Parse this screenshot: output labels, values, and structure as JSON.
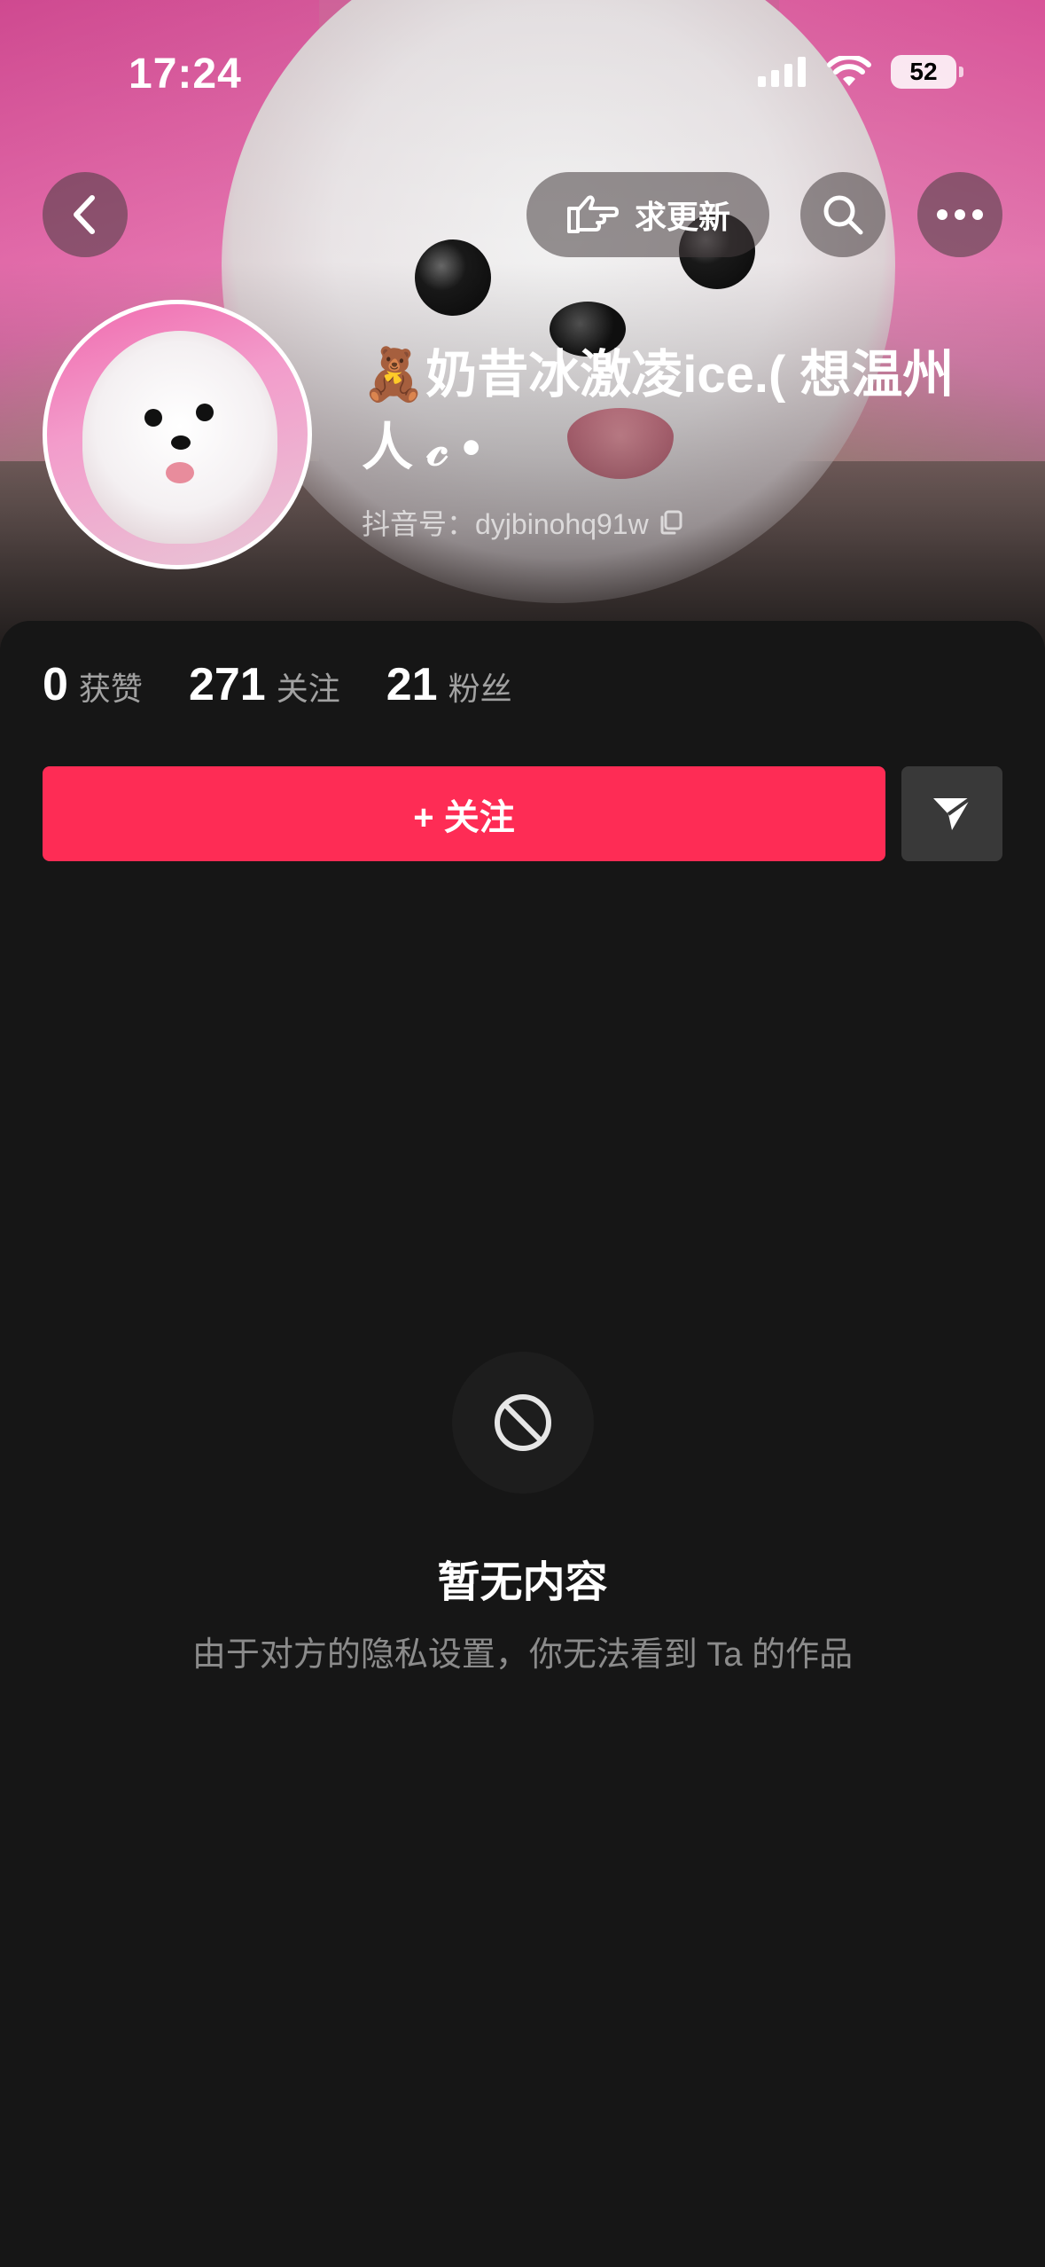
{
  "status_bar": {
    "time": "17:24",
    "battery": "52"
  },
  "header": {
    "update_label": "求更新",
    "name": "🧸奶昔冰激凌ice.( 想温州人 𝒸 •",
    "douyin_id": "抖音号：dyjbinohq91w"
  },
  "stats": [
    {
      "value": "0",
      "label": "获赞"
    },
    {
      "value": "271",
      "label": "关注"
    },
    {
      "value": "21",
      "label": "粉丝"
    }
  ],
  "actions": {
    "follow_label": "+ 关注"
  },
  "empty_state": {
    "title": "暂无内容",
    "description": "由于对方的隐私设置，你无法看到 Ta 的作品"
  },
  "colors": {
    "accent": "#fe2c55",
    "background": "#161616",
    "share_button": "#393939"
  },
  "icons": [
    "back-icon",
    "pointing-hand-icon",
    "search-icon",
    "more-icon",
    "copy-icon",
    "share-icon",
    "prohibited-icon"
  ]
}
